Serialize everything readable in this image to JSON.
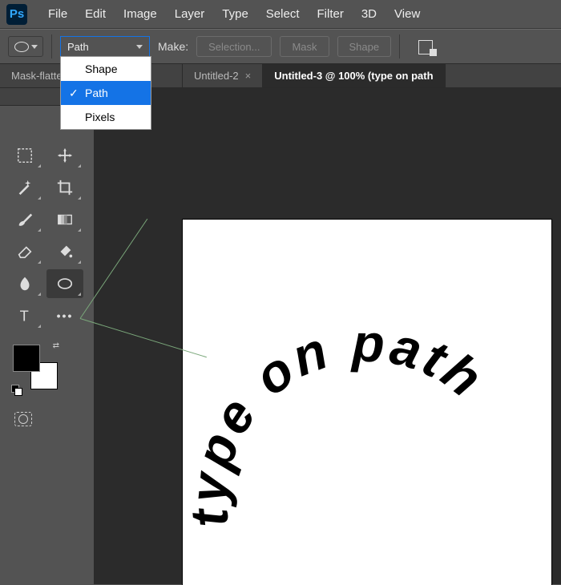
{
  "menubar": {
    "items": [
      "File",
      "Edit",
      "Image",
      "Layer",
      "Type",
      "Select",
      "Filter",
      "3D",
      "View"
    ]
  },
  "options_bar": {
    "mode_select": {
      "value": "Path",
      "options": [
        "Shape",
        "Path",
        "Pixels"
      ],
      "selected_index": 1
    },
    "make_label": "Make:",
    "buttons": {
      "selection": "Selection...",
      "mask": "Mask",
      "shape": "Shape"
    }
  },
  "tabs": [
    {
      "label": "Mask-flatte",
      "active": false,
      "closeable": true
    },
    {
      "label": "Untitled-2",
      "active": false,
      "closeable": true
    },
    {
      "label": "Untitled-3 @ 100% (type on path",
      "active": true,
      "closeable": false
    }
  ],
  "tools": {
    "cells": [
      {
        "name": "marquee-tool-icon"
      },
      {
        "name": "move-tool-icon"
      },
      {
        "name": "magic-wand-tool-icon"
      },
      {
        "name": "crop-tool-icon"
      },
      {
        "name": "brush-tool-icon"
      },
      {
        "name": "gradient-tool-icon"
      },
      {
        "name": "eraser-tool-icon"
      },
      {
        "name": "paint-bucket-tool-icon"
      },
      {
        "name": "smudge-tool-icon"
      },
      {
        "name": "ellipse-tool-icon",
        "active": true
      },
      {
        "name": "type-tool-icon"
      },
      {
        "name": "more-tools-icon"
      }
    ]
  },
  "swatches": {
    "foreground": "#000000",
    "background": "#ffffff"
  },
  "canvas": {
    "text": "type on path"
  },
  "colors": {
    "accent": "#1473e6",
    "panel": "#535353",
    "canvas_bg": "#2b2b2b"
  }
}
